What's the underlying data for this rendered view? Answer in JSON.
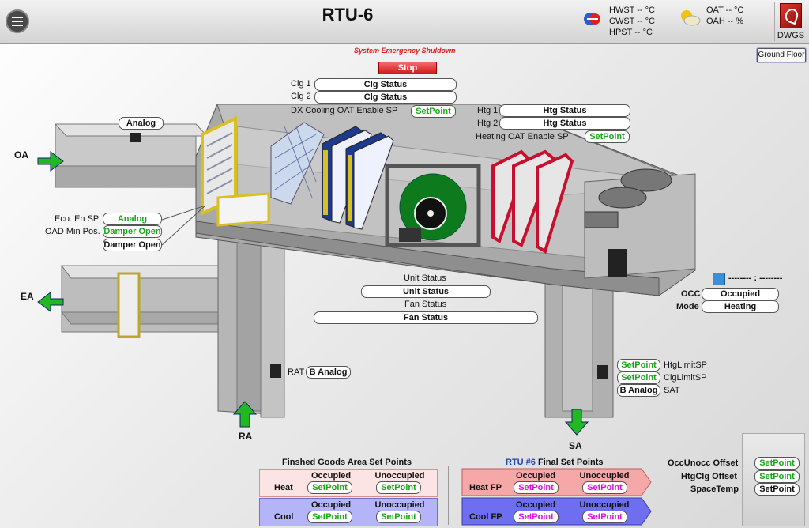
{
  "header": {
    "title": "RTU-6",
    "hwst": "HWST -- °C",
    "cwst": "CWST -- °C",
    "hpst": "HPST -- °C",
    "oat": "OAT -- °C",
    "oah": "OAH -- %",
    "dwgs_label": "DWGS"
  },
  "emergency": {
    "label": "System Emergency Shuldown",
    "stop_label": "Stop"
  },
  "ground_floor_label": "Ground Floor",
  "cooling": {
    "clg1_label": "Clg 1",
    "clg1_value": "Clg Status",
    "clg2_label": "Clg 2",
    "clg2_value": "Clg Status",
    "dx_label": "DX Cooling OAT Enable SP",
    "dx_value": "SetPoint"
  },
  "heating": {
    "htg1_label": "Htg 1",
    "htg1_value": "Htg Status",
    "htg2_label": "Htg 2",
    "htg2_value": "Htg Status",
    "oat_label": "Heating OAT Enable SP",
    "oat_value": "SetPoint"
  },
  "oa": {
    "label": "OA",
    "sensor": "Analog"
  },
  "ea": {
    "label": "EA"
  },
  "economizer": {
    "eco_label": "Eco. En SP",
    "eco_value": "Analog",
    "oad_label": "OAD Min Pos.",
    "oad_value": "Damper Open",
    "damper_value": "Damper Open"
  },
  "unit": {
    "unit_status_label": "Unit Status",
    "unit_status_value": "Unit Status",
    "fan_status_label": "Fan Status",
    "fan_status_value": "Fan Status"
  },
  "schedule": {
    "time_text": "-------- : --------"
  },
  "occ": {
    "occ_label": "OCC",
    "occ_value": "Occupied",
    "mode_label": "Mode",
    "mode_value": "Heating"
  },
  "ra": {
    "label": "RA",
    "rat_label": "RAT",
    "rat_value": "B Analog"
  },
  "sa": {
    "label": "SA",
    "htg_limit_value": "SetPoint",
    "htg_limit_label": "HtgLimitSP",
    "clg_limit_value": "SetPoint",
    "clg_limit_label": "ClgLimitSP",
    "sat_value": "B Analog",
    "sat_label": "SAT"
  },
  "fg_setpoints": {
    "title": "Finshed Goods Area Set Points",
    "occupied_header": "Occupied",
    "unoccupied_header": "Unoccupied",
    "heat_label": "Heat",
    "heat_occ": "SetPoint",
    "heat_unocc": "SetPoint",
    "cool_label": "Cool",
    "cool_occ": "SetPoint",
    "cool_unocc": "SetPoint",
    "heat_color": "#fde4e4",
    "cool_color": "#b4b4f8"
  },
  "rtu_final": {
    "title_prefix": "RTU #6",
    "title_suffix": "Final Set Points",
    "occupied_header": "Occupied",
    "unoccupied_header": "Unoccupied",
    "heat_label": "Heat FP",
    "heat_occ": "SetPoint",
    "heat_unocc": "SetPoint",
    "cool_label": "Cool FP",
    "cool_occ": "SetPoint",
    "cool_unocc": "SetPoint",
    "heat_color": "#f6a8a8",
    "cool_color": "#6e6ef0"
  },
  "offsets": {
    "occunocc_label": "OccUnocc Offset",
    "occunocc_value": "SetPoint",
    "htgclg_label": "HtgClg Offset",
    "htgclg_value": "SetPoint",
    "spacetemp_label": "SpaceTemp",
    "spacetemp_value": "SetPoint"
  },
  "colors": {
    "accent_green": "#1aa51a",
    "stop_red": "#d21a1a",
    "arrow_green": "#22b822",
    "heat_coil": "#c8102e",
    "fan_green": "#0d7a1e"
  }
}
